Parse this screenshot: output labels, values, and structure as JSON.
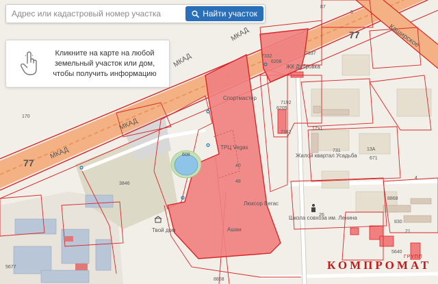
{
  "search": {
    "placeholder": "Адрес или кадастровый номер участка",
    "button_label": "Найти участок"
  },
  "hint": {
    "text": "Кликните на карте на любой земельный участок или дом, чтобы получить информацию",
    "icon": "hand-pointer-icon"
  },
  "map": {
    "road_labels": [
      "МКАД",
      "МКАД",
      "МКАД",
      "МКАД",
      "Каширское"
    ],
    "route_numbers": [
      "77",
      "77"
    ],
    "places": [
      "Спортмастер",
      "ТРЦ Vegas",
      "Люксор Вегас",
      "Ашан",
      "Твой дом",
      "ЖК Дубровка",
      "Жилой квартал Усадьба",
      "Школа совхоза им. Ленина"
    ],
    "parcel_numbers": [
      "7332",
      "6208",
      "7337",
      "6205",
      "7192",
      "7162",
      "17э1",
      "731",
      "4",
      "13А",
      "671",
      "8868",
      "830",
      "3846",
      "5677",
      "5640",
      "608",
      "40",
      "8868",
      "26",
      "48",
      "21",
      "170",
      "5",
      "87"
    ],
    "colors": {
      "highlight": "#f08080",
      "road": "#f4b183",
      "boundary": "#d62728"
    }
  },
  "watermark": {
    "text": "КОМПРОМАТ",
    "sup": "ГРУПП"
  }
}
